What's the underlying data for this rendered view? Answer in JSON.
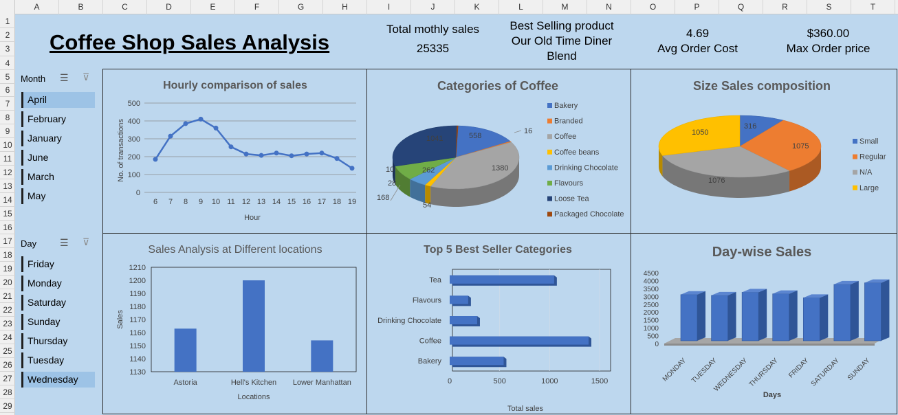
{
  "columns": [
    "A",
    "B",
    "C",
    "D",
    "E",
    "F",
    "G",
    "H",
    "I",
    "J",
    "K",
    "L",
    "M",
    "N",
    "O",
    "P",
    "Q",
    "R",
    "S",
    "T"
  ],
  "rows": [
    "1",
    "2",
    "3",
    "4",
    "5",
    "6",
    "7",
    "8",
    "9",
    "10",
    "11",
    "12",
    "13",
    "14",
    "15",
    "16",
    "17",
    "18",
    "19",
    "20",
    "21",
    "22",
    "23",
    "24",
    "25",
    "26",
    "27",
    "28",
    "29"
  ],
  "title": "Coffee Shop Sales Analysis",
  "kpis": {
    "sales_label": "Total mothly sales",
    "sales_value": "25335",
    "best_label_1": "Best Selling product",
    "best_label_2": "Our Old Time Diner",
    "best_label_3": "Blend",
    "avg_value": "4.69",
    "avg_label": "Avg Order Cost",
    "max_value": "$360.00",
    "max_label": "Max Order price"
  },
  "month_slicer": {
    "title": "Month",
    "items": [
      "April",
      "February",
      "January",
      "June",
      "March",
      "May"
    ],
    "selected": "April"
  },
  "day_slicer": {
    "title": "Day",
    "items": [
      "Friday",
      "Monday",
      "Saturday",
      "Sunday",
      "Thursday",
      "Tuesday",
      "Wednesday"
    ],
    "selected": "Wednesday"
  },
  "colors": {
    "accent": "#4472c4",
    "background": "#bdd7ee",
    "selected": "#9dc3e6"
  },
  "chart_data": [
    {
      "type": "line",
      "title": "Hourly comparison of sales",
      "xlabel": "Hour",
      "ylabel": "No. of transactions",
      "x": [
        6,
        7,
        8,
        9,
        10,
        11,
        12,
        13,
        14,
        15,
        16,
        17,
        18,
        19
      ],
      "values": [
        185,
        315,
        385,
        410,
        360,
        255,
        215,
        207,
        220,
        205,
        215,
        220,
        190,
        135
      ],
      "ylim": [
        0,
        500
      ],
      "yticks": [
        0,
        100,
        200,
        300,
        400,
        500
      ],
      "grid": true
    },
    {
      "type": "pie",
      "title": "Categories of Coffee",
      "labels": [
        "Bakery",
        "Branded",
        "Coffee",
        "Coffee beans",
        "Drinking Chocolate",
        "Flavours",
        "Loose Tea",
        "Packaged Chocolate"
      ],
      "values": [
        558,
        16,
        1380,
        54,
        168,
        262,
        1041,
        10
      ],
      "data_labels": [
        "558",
        "16",
        "1380",
        "54",
        "168",
        "262",
        "1041",
        "10",
        "28"
      ],
      "colors": [
        "#4472c4",
        "#ed7d31",
        "#a5a5a5",
        "#ffc000",
        "#5b9bd5",
        "#70ad47",
        "#264478",
        "#9e480e"
      ],
      "legend": "right"
    },
    {
      "type": "pie",
      "title": "Size Sales composition",
      "labels": [
        "Small",
        "Regular",
        "N/A",
        "Large"
      ],
      "values": [
        316,
        1075,
        1076,
        1050
      ],
      "colors": [
        "#4472c4",
        "#ed7d31",
        "#a5a5a5",
        "#ffc000"
      ],
      "legend": "right"
    },
    {
      "type": "bar",
      "title": "Sales Analysis at Different locations",
      "categories": [
        "Astoria",
        "Hell's Kitchen",
        "Lower Manhattan"
      ],
      "values": [
        1163,
        1200,
        1154
      ],
      "xlabel": "Locations",
      "ylabel": "Sales",
      "ylim": [
        1130,
        1210
      ],
      "yticks": [
        1130,
        1140,
        1150,
        1160,
        1170,
        1180,
        1190,
        1200,
        1210
      ]
    },
    {
      "type": "bar",
      "orientation": "horizontal",
      "title": "Top 5 Best Seller Categories",
      "categories": [
        "Tea",
        "Flavours",
        "Drinking Chocolate",
        "Coffee",
        "Bakery"
      ],
      "values": [
        1045,
        185,
        275,
        1390,
        540
      ],
      "xlabel": "Total sales",
      "xlim": [
        0,
        1500
      ],
      "xticks": [
        0,
        500,
        1000,
        1500
      ]
    },
    {
      "type": "bar",
      "title": "Day-wise Sales",
      "categories": [
        "MONDAY",
        "TUESDAY",
        "WEDNESDAY",
        "THURSDAY",
        "FRIDAY",
        "SATURDAY",
        "SUNDAY"
      ],
      "values": [
        3200,
        3150,
        3350,
        3250,
        3000,
        3850,
        3950
      ],
      "xlabel": "Days",
      "ylim": [
        0,
        4500
      ],
      "yticks": [
        0,
        500,
        1000,
        1500,
        2000,
        2500,
        3000,
        3500,
        4000,
        4500
      ]
    }
  ]
}
